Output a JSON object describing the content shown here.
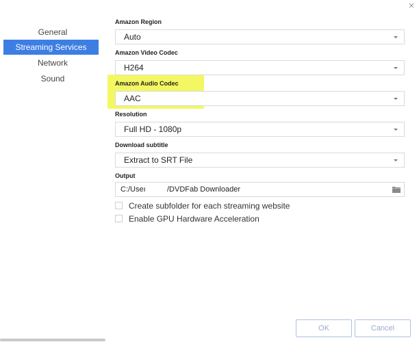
{
  "window": {
    "close_glyph": "×"
  },
  "sidebar": {
    "items": [
      {
        "label": "General",
        "active": false
      },
      {
        "label": "Streaming Services",
        "active": true
      },
      {
        "label": "Network",
        "active": false
      },
      {
        "label": "Sound",
        "active": false
      }
    ]
  },
  "settings": {
    "amazon_region": {
      "label": "Amazon Region",
      "value": "Auto"
    },
    "amazon_video_codec": {
      "label": "Amazon Video Codec",
      "value": "H264"
    },
    "amazon_audio_codec": {
      "label": "Amazon Audio Codec",
      "value": "AAC"
    },
    "resolution": {
      "label": "Resolution",
      "value": "Full HD - 1080p"
    },
    "download_subtitle": {
      "label": "Download subtitle",
      "value": "Extract to SRT File"
    },
    "output": {
      "label": "Output",
      "path_start": "C:/Useı",
      "path_end": "/DVDFab Downloader"
    }
  },
  "checkboxes": {
    "subfolder": {
      "label": "Create subfolder for each streaming website",
      "checked": false
    },
    "gpu": {
      "label": "Enable GPU Hardware Acceleration",
      "checked": false
    }
  },
  "buttons": {
    "ok": "OK",
    "cancel": "Cancel"
  },
  "colors": {
    "accent": "#3d7ee3",
    "highlight": "#eef526",
    "button_border": "#aebfe5"
  },
  "icons": {
    "folder": "folder-icon",
    "close": "close-icon",
    "dropdown": "chevron-down-icon"
  }
}
